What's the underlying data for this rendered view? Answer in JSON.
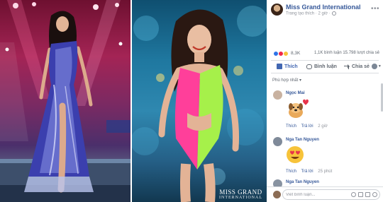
{
  "post": {
    "page_name": "Miss Grand International",
    "meta": "Trang tạo thích · 2 giờ ·"
  },
  "photos": {
    "watermark_line1": "MISS GRAND",
    "watermark_line2": "INTERNATIONAL"
  },
  "stats": {
    "reaction_count": "8,3K",
    "comments_shares": "1,1K bình luận   15.798 lượt chia sẻ"
  },
  "actions": {
    "like_label": "Thích",
    "comment_label": "Bình luận",
    "share_label": "Chia sẻ"
  },
  "sort_label": "Phù hợp nhất ▾",
  "comments": [
    {
      "name": "Ngọc Mai",
      "like": "Thích",
      "reply": "Trả lời",
      "time": "2 giờ"
    },
    {
      "name": "Nga Tan Nguyen",
      "like": "Thích",
      "reply": "Trả lời",
      "time": "25 phút"
    },
    {
      "name": "Nga Tan Nguyen"
    }
  ],
  "composer": {
    "placeholder": "Viết bình luận..."
  },
  "colors": {
    "link_blue": "#365899",
    "action_blue": "#4267b2",
    "muted_gray": "#90949c"
  }
}
